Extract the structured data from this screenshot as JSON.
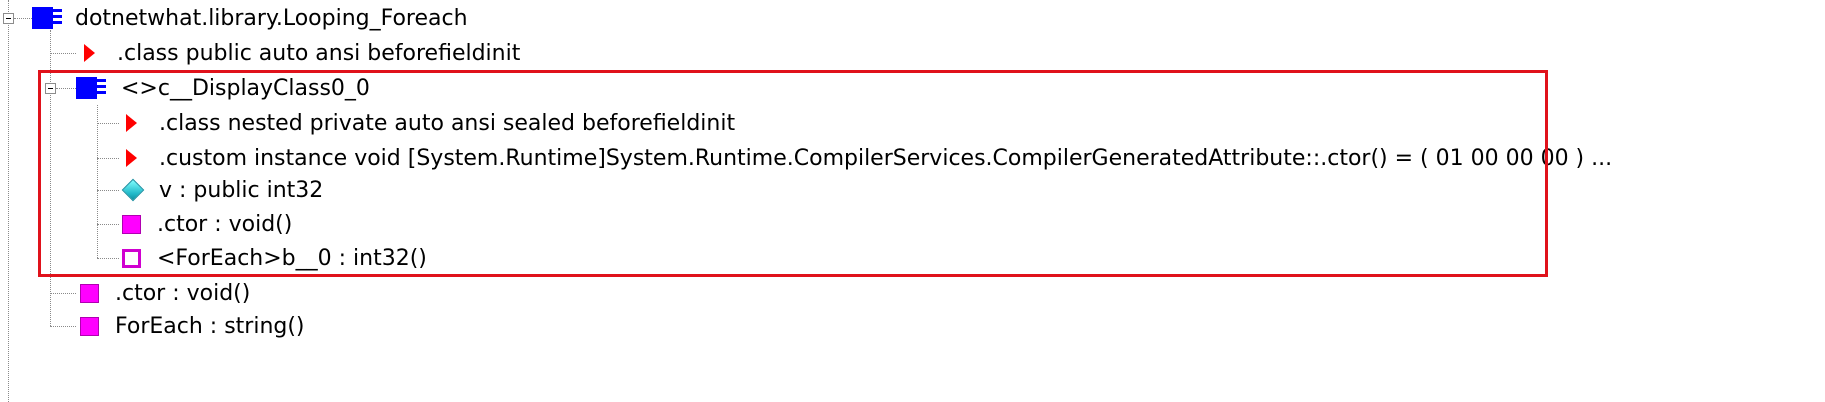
{
  "tree": {
    "root": {
      "label": "dotnetwhat.library.Looping_Foreach",
      "icon": "class-icon"
    },
    "items": [
      {
        "label": ".class public auto ansi beforefieldinit",
        "icon": "red-triangle-icon"
      },
      {
        "label": "<>c__DisplayClass0_0",
        "icon": "class-icon"
      },
      {
        "label": ".class nested private auto ansi sealed beforefieldinit",
        "icon": "red-triangle-icon"
      },
      {
        "label": ".custom instance void [System.Runtime]System.Runtime.CompilerServices.CompilerGeneratedAttribute::.ctor() = ( 01 00 00 00 )  ...",
        "icon": "red-triangle-icon"
      },
      {
        "label": "v : public int32",
        "icon": "field-icon"
      },
      {
        "label": ".ctor : void()",
        "icon": "method-icon"
      },
      {
        "label": "<ForEach>b__0 : int32()",
        "icon": "hollow-method-icon"
      },
      {
        "label": ".ctor : void()",
        "icon": "method-icon"
      },
      {
        "label": "ForEach : string()",
        "icon": "method-icon"
      }
    ]
  },
  "colors": {
    "highlight_border": "#e0121b",
    "class_icon": "#0000ff",
    "method_icon": "#ff00ff",
    "triangle_icon": "#ff0000",
    "field_icon": "#1fb7c7"
  }
}
